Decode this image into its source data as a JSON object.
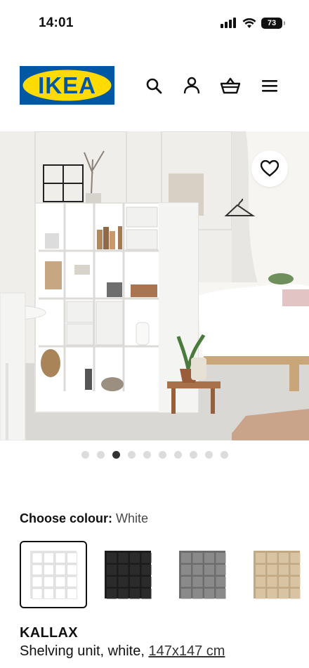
{
  "status_bar": {
    "time": "14:01",
    "battery": "73"
  },
  "header": {
    "logo_text": "IKEA",
    "icons": [
      "search-icon",
      "user-icon",
      "basket-icon",
      "menu-icon"
    ]
  },
  "gallery": {
    "total_images": 10,
    "active_index": 2,
    "favorite_icon": "heart-icon"
  },
  "colour": {
    "label": "Choose colour:",
    "selected_value": "White",
    "options": [
      {
        "name": "White",
        "color": "#ffffff",
        "frame": "#e4e4e4",
        "selected": true
      },
      {
        "name": "Black-brown",
        "color": "#2b2b2b",
        "frame": "#1c1c1c",
        "selected": false
      },
      {
        "name": "Grey",
        "color": "#8a8a8a",
        "frame": "#6d6d6d",
        "selected": false
      },
      {
        "name": "Oak effect",
        "color": "#d8c3a3",
        "frame": "#c2a883",
        "selected": false
      }
    ]
  },
  "product": {
    "name": "KALLAX",
    "description": "Shelving unit, white,",
    "size": "147x147 cm"
  },
  "colors": {
    "ikea_blue": "#0058a3",
    "ikea_yellow": "#ffdb00"
  }
}
